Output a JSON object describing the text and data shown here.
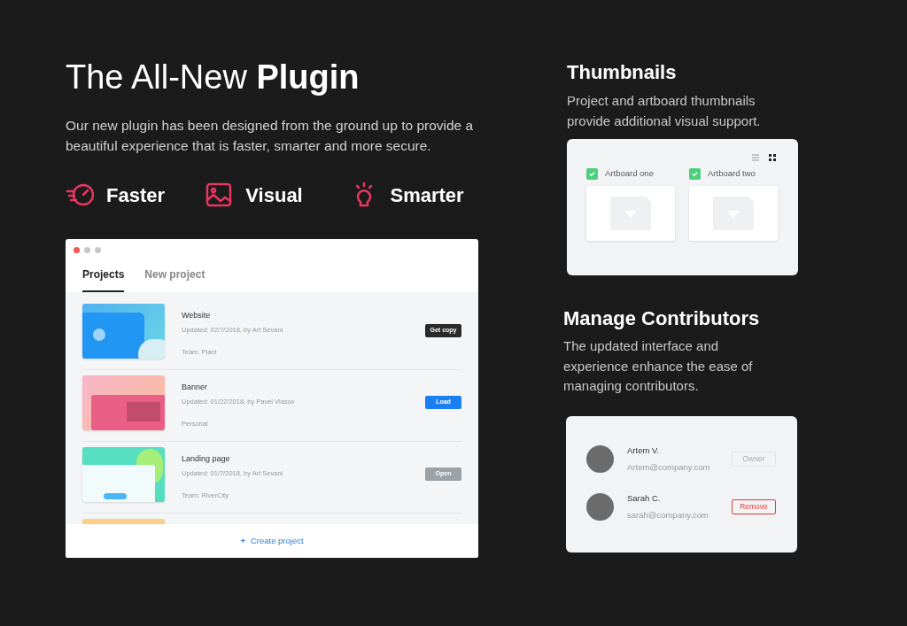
{
  "hero": {
    "title": "The All-New **Plugin**",
    "description": "Our new plugin has been designed from the ground up to provide a beautiful experience that is faster, smarter and more secure."
  },
  "features": [
    {
      "kind": "speed",
      "label": "Faster"
    },
    {
      "kind": "image",
      "label": "Visual"
    },
    {
      "kind": "bulb",
      "label": "Smarter"
    }
  ],
  "projects_window": {
    "tabs": [
      {
        "label": "Projects",
        "selected": true
      },
      {
        "label": "New project",
        "selected": false
      }
    ],
    "rows": [
      {
        "kind": "blue",
        "title": "Website",
        "updated": "Updated: 02/7/2018, by Art Sevani",
        "team": "Team: Plant",
        "button": {
          "label": "Get copy",
          "kind": "dark"
        }
      },
      {
        "kind": "pink",
        "title": "Banner",
        "updated": "Updated: 01/22/2018,  by Pavel Vlasov",
        "team": "Personal",
        "button": {
          "label": "Load",
          "kind": "primary"
        }
      },
      {
        "kind": "green",
        "title": "Landing page",
        "updated": "Updated: 01/7/2018,  by Art Sevani",
        "team": "Team: RiverCity",
        "button": {
          "label": "Open",
          "kind": "disabled"
        }
      },
      {
        "kind": "orange"
      }
    ],
    "create_button": {
      "icon": "+",
      "label": "Create project"
    }
  },
  "thumbnails": {
    "title": "Thumbnails",
    "description": "Project and artboard thumbnails provide additional visual support.",
    "view_modes": [
      {
        "kind": "list",
        "selected": false
      },
      {
        "kind": "grid",
        "selected": true
      }
    ],
    "artboards": [
      {
        "label": "Artboard one",
        "checked": true
      },
      {
        "label": "Artboard two",
        "checked": true
      }
    ]
  },
  "contributors": {
    "title": "Manage Contributors",
    "description": "The updated interface and experience enhance the ease of managing contributors.",
    "people": [
      {
        "name": "Artem V.",
        "email": "Artem@company.com",
        "action": {
          "label": "Owner",
          "kind": "owner"
        }
      },
      {
        "name": "Sarah C.",
        "email": "sarah@company.com",
        "action": {
          "label": "Remove",
          "kind": "remove"
        }
      }
    ]
  }
}
